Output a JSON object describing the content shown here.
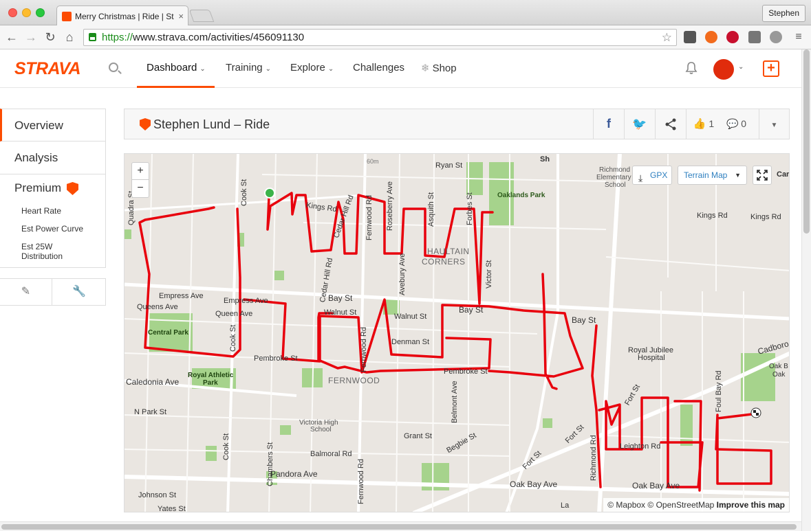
{
  "browser": {
    "tab_title": "Merry Christmas | Ride | St",
    "url_scheme": "https://",
    "url_rest": "www.strava.com/activities/456091130",
    "profile_name": "Stephen"
  },
  "header": {
    "logo": "STRAVA",
    "menu": [
      {
        "label": "Dashboard"
      },
      {
        "label": "Training"
      },
      {
        "label": "Explore"
      },
      {
        "label": "Challenges"
      },
      {
        "label": "Shop"
      }
    ]
  },
  "sidebar": {
    "overview": "Overview",
    "analysis": "Analysis",
    "premium": "Premium",
    "premium_items": [
      "Heart Rate",
      "Est Power Curve",
      "Est 25W Distribution"
    ]
  },
  "activity": {
    "title": "Stephen Lund – Ride",
    "kudos_count": "1",
    "comment_count": "0"
  },
  "map": {
    "gpx_label": "GPX",
    "map_type": "Terrain Map",
    "attribution_1": "© Mapbox",
    "attribution_2": "© OpenStreetMap",
    "attribution_3": "Improve this map",
    "zoom_in": "+",
    "zoom_out": "−",
    "labels": {
      "ryan_st": "Ryan St",
      "kings_rd": "Kings Rd",
      "kings_rd_2": "Kings Rd",
      "kings_rd_3": "Kings Rd",
      "oaklands_park": "Oaklands Park",
      "richmond_school_1": "Richmond",
      "richmond_school_2": "Elementary",
      "richmond_school_3": "School",
      "haultain_1": "HAULTAIN",
      "haultain_2": "CORNERS",
      "empress_ave": "Empress Ave",
      "empress_ave_2": "Empress Ave",
      "queens_ave": "Queens Ave",
      "queen_ave_2": "Queen Ave",
      "bay_st": "Bay St",
      "bay_st_2": "Bay St",
      "bay_st_3": "Bay St",
      "walnut_st": "Walnut St",
      "walnut_st_2": "Walnut St",
      "denman_st": "Denman St",
      "central_park": "Central Park",
      "pembroke_st": "Pembroke St",
      "pembroke_st_2": "Pembroke St",
      "royal_athletic_1": "Royal Athletic",
      "royal_athletic_2": "Park",
      "fernwood": "FERNWOOD",
      "caledonia_ave": "Caledonia Ave",
      "n_park_st": "N Park St",
      "victoria_high_1": "Victoria High",
      "victoria_high_2": "School",
      "grant_st": "Grant St",
      "balmoral_rd": "Balmoral Rd",
      "pandora_ave": "Pandora Ave",
      "johnson_st": "Johnson St",
      "yates_st": "Yates St",
      "begbie_st": "Begbie St",
      "fort_st": "Fort St",
      "fort_st_2": "Fort St",
      "fort_st_3": "Fort St",
      "oak_bay_ave": "Oak Bay Ave",
      "oak_bay_ave_2": "Oak Bay Ave",
      "leighton_rd": "Leighton Rd",
      "royal_jubilee_1": "Royal Jubilee",
      "royal_jubilee_2": "Hospital",
      "cadboro": "Cadboro",
      "oak_bay_1": "Oak B",
      "oak_bay_2": "Oak",
      "car": "Car",
      "sixty_m": "60m",
      "quadra_st": "Quadra St",
      "cook_st": "Cook St",
      "cook_st_2": "Cook St",
      "cook_st_3": "Cook St",
      "cedar_hill_rd": "Cedar Hill Rd",
      "cedar_hill_rd_2": "Cedar Hill Rd",
      "fernwood_rd": "Fernwood Rd",
      "fernwood_rd_2": "Fernwood Rd",
      "fernwood_rd_3": "Fernwood Rd",
      "roseberry_ave": "Roseberry Ave",
      "avebury_ave": "Avebury Ave",
      "asquith_st": "Asquith St",
      "forbes_st": "Forbes St",
      "victor_st": "Victor St",
      "belmont_ave": "Belmont Ave",
      "chambers_st": "Chambers St",
      "richmond_rd": "Richmond Rd",
      "foul_bay_rd": "Foul Bay Rd",
      "sh": "Sh",
      "la": "La"
    }
  },
  "colors": {
    "brand": "#fc4c02",
    "route": "#e8000d",
    "park": "#8fc870"
  }
}
